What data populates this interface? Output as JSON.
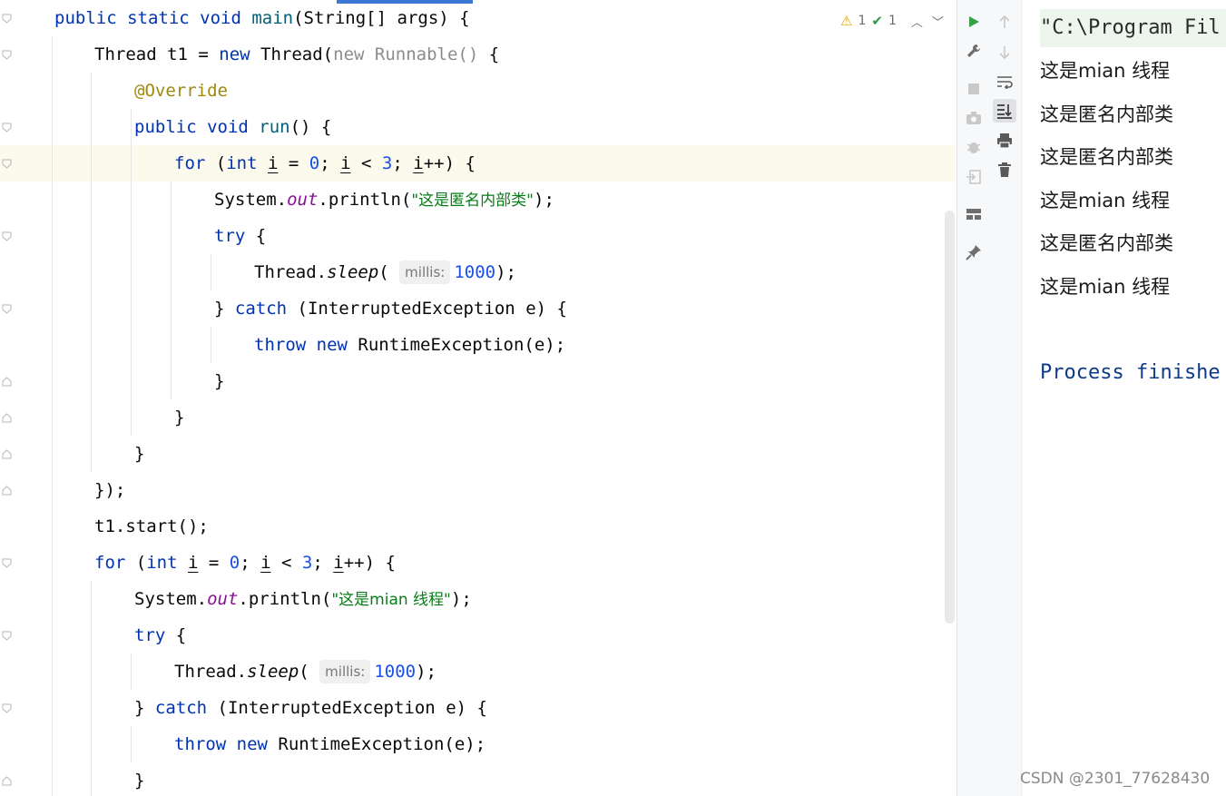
{
  "editor": {
    "inspection": {
      "warnings": "1",
      "typos": "1"
    },
    "lines": [
      {
        "parts": [
          {
            "t": "public static void ",
            "c": "kw"
          },
          {
            "t": "main",
            "c": "fn"
          },
          {
            "t": "(String[] args) {"
          }
        ]
      },
      {
        "parts": [
          {
            "t": "Thread t1 = "
          },
          {
            "t": "new ",
            "c": "kw"
          },
          {
            "t": "Thread("
          },
          {
            "t": "new Runnable() ",
            "c": "gray"
          },
          {
            "t": "{"
          }
        ]
      },
      {
        "parts": [
          {
            "t": "@Override",
            "c": "ann"
          }
        ]
      },
      {
        "parts": [
          {
            "t": "public void ",
            "c": "kw"
          },
          {
            "t": "run",
            "c": "fn"
          },
          {
            "t": "() {"
          }
        ]
      },
      {
        "parts": [
          {
            "t": "for ",
            "c": "kw"
          },
          {
            "t": "("
          },
          {
            "t": "int ",
            "c": "kw"
          },
          {
            "t": "i",
            "c": "var-u"
          },
          {
            "t": " = "
          },
          {
            "t": "0",
            "c": "num"
          },
          {
            "t": "; "
          },
          {
            "t": "i",
            "c": "var-u"
          },
          {
            "t": " < "
          },
          {
            "t": "3",
            "c": "num"
          },
          {
            "t": "; "
          },
          {
            "t": "i",
            "c": "var-u"
          },
          {
            "t": "++) {"
          }
        ]
      },
      {
        "parts": [
          {
            "t": "System."
          },
          {
            "t": "out",
            "c": "field"
          },
          {
            "t": ".println("
          },
          {
            "t": "\"这是匿名内部类\"",
            "c": "str"
          },
          {
            "t": ");"
          }
        ]
      },
      {
        "parts": [
          {
            "t": "try ",
            "c": "kw"
          },
          {
            "t": "{"
          }
        ]
      },
      {
        "parts": [
          {
            "t": "Thread."
          },
          {
            "t": "sleep",
            "c": "static-m"
          },
          {
            "t": "( "
          },
          {
            "t": "millis:",
            "c": "hint"
          },
          {
            "t": "1000",
            "c": "num"
          },
          {
            "t": ");"
          }
        ]
      },
      {
        "parts": [
          {
            "t": "} "
          },
          {
            "t": "catch ",
            "c": "kw"
          },
          {
            "t": "(InterruptedException e) {"
          }
        ]
      },
      {
        "parts": [
          {
            "t": "throw new ",
            "c": "kw"
          },
          {
            "t": "RuntimeException(e);"
          }
        ]
      },
      {
        "parts": [
          {
            "t": "}"
          }
        ]
      },
      {
        "parts": [
          {
            "t": "}"
          }
        ]
      },
      {
        "parts": [
          {
            "t": "}"
          }
        ]
      },
      {
        "parts": [
          {
            "t": "});"
          }
        ]
      },
      {
        "parts": [
          {
            "t": "t1.start();"
          }
        ]
      },
      {
        "parts": [
          {
            "t": "for ",
            "c": "kw"
          },
          {
            "t": "("
          },
          {
            "t": "int ",
            "c": "kw"
          },
          {
            "t": "i",
            "c": "var-u"
          },
          {
            "t": " = "
          },
          {
            "t": "0",
            "c": "num"
          },
          {
            "t": "; "
          },
          {
            "t": "i",
            "c": "var-u"
          },
          {
            "t": " < "
          },
          {
            "t": "3",
            "c": "num"
          },
          {
            "t": "; "
          },
          {
            "t": "i",
            "c": "var-u"
          },
          {
            "t": "++) {"
          }
        ]
      },
      {
        "parts": [
          {
            "t": "System."
          },
          {
            "t": "out",
            "c": "field"
          },
          {
            "t": ".println("
          },
          {
            "t": "\"这是mian 线程\"",
            "c": "str"
          },
          {
            "t": ");"
          }
        ]
      },
      {
        "parts": [
          {
            "t": "try ",
            "c": "kw"
          },
          {
            "t": "{"
          }
        ]
      },
      {
        "parts": [
          {
            "t": "Thread."
          },
          {
            "t": "sleep",
            "c": "static-m"
          },
          {
            "t": "( "
          },
          {
            "t": "millis:",
            "c": "hint"
          },
          {
            "t": "1000",
            "c": "num"
          },
          {
            "t": ");"
          }
        ]
      },
      {
        "parts": [
          {
            "t": "} "
          },
          {
            "t": "catch ",
            "c": "kw"
          },
          {
            "t": "(InterruptedException e) {"
          }
        ]
      },
      {
        "parts": [
          {
            "t": "throw new ",
            "c": "kw"
          },
          {
            "t": "RuntimeException(e);"
          }
        ]
      },
      {
        "parts": [
          {
            "t": "}"
          }
        ]
      }
    ]
  },
  "run_toolbar": [
    "run-icon",
    "wrench-icon",
    "stop-icon",
    "camera-icon",
    "debug-bug-icon",
    "exit-icon",
    "layout-icon",
    "pin-icon"
  ],
  "console_toolbar": [
    "arrow-up-icon",
    "arrow-down-icon",
    "soft-wrap-icon",
    "scroll-to-end-icon",
    "print-icon",
    "trash-icon"
  ],
  "console": {
    "command": "\"C:\\Program Fil",
    "lines": [
      "这是mian 线程",
      "这是匿名内部类",
      "这是匿名内部类",
      "这是mian 线程",
      "这是匿名内部类",
      "这是mian 线程"
    ],
    "process": "Process finishe"
  },
  "watermark": "CSDN @2301_77628430"
}
